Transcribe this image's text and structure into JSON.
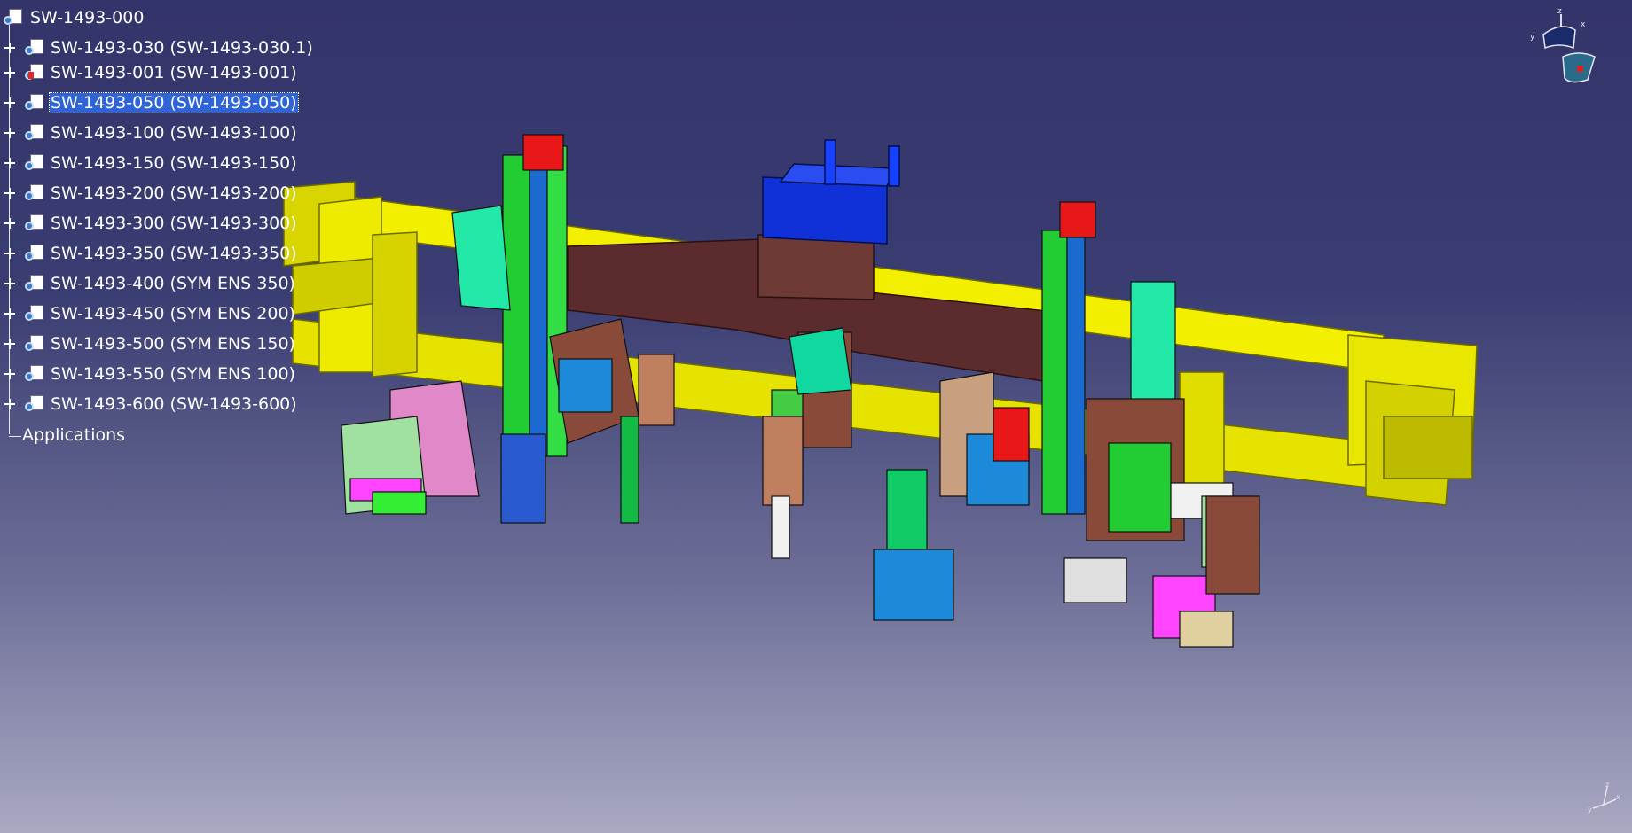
{
  "tree": {
    "root_label": "SW-1493-000",
    "nodes": [
      {
        "label": "SW-1493-030 (SW-1493-030.1)",
        "selected": false
      },
      {
        "label": "SW-1493-001 (SW-1493-001)",
        "selected": false
      },
      {
        "label": "SW-1493-050 (SW-1493-050)",
        "selected": true
      },
      {
        "label": "SW-1493-100 (SW-1493-100)",
        "selected": false
      },
      {
        "label": "SW-1493-150 (SW-1493-150)",
        "selected": false
      },
      {
        "label": "SW-1493-200 (SW-1493-200)",
        "selected": false
      },
      {
        "label": "SW-1493-300 (SW-1493-300)",
        "selected": false
      },
      {
        "label": "SW-1493-350 (SW-1493-350)",
        "selected": false
      },
      {
        "label": "SW-1493-400 (SYM ENS 350)",
        "selected": false
      },
      {
        "label": "SW-1493-450 (SYM ENS 200)",
        "selected": false
      },
      {
        "label": "SW-1493-500 (SYM ENS 150)",
        "selected": false
      },
      {
        "label": "SW-1493-550 (SYM ENS 100)",
        "selected": false
      },
      {
        "label": "SW-1493-600 (SW-1493-600)",
        "selected": false
      }
    ],
    "applications_label": "Applications"
  },
  "compass": {
    "axis_x": "x",
    "axis_y": "y",
    "axis_z": "z"
  },
  "axis_triad": {
    "x": "x",
    "y": "y",
    "z": "z"
  },
  "colors": {
    "background_top": "#33346a",
    "background_bottom": "#a9a9c3",
    "selection": "#2f64d6",
    "frame_yellow": "#f2f000",
    "beam_brown": "#5a2a2a"
  },
  "icons": [
    "product-icon",
    "expand-plus-icon",
    "compass-icon",
    "axis-triad-icon"
  ]
}
